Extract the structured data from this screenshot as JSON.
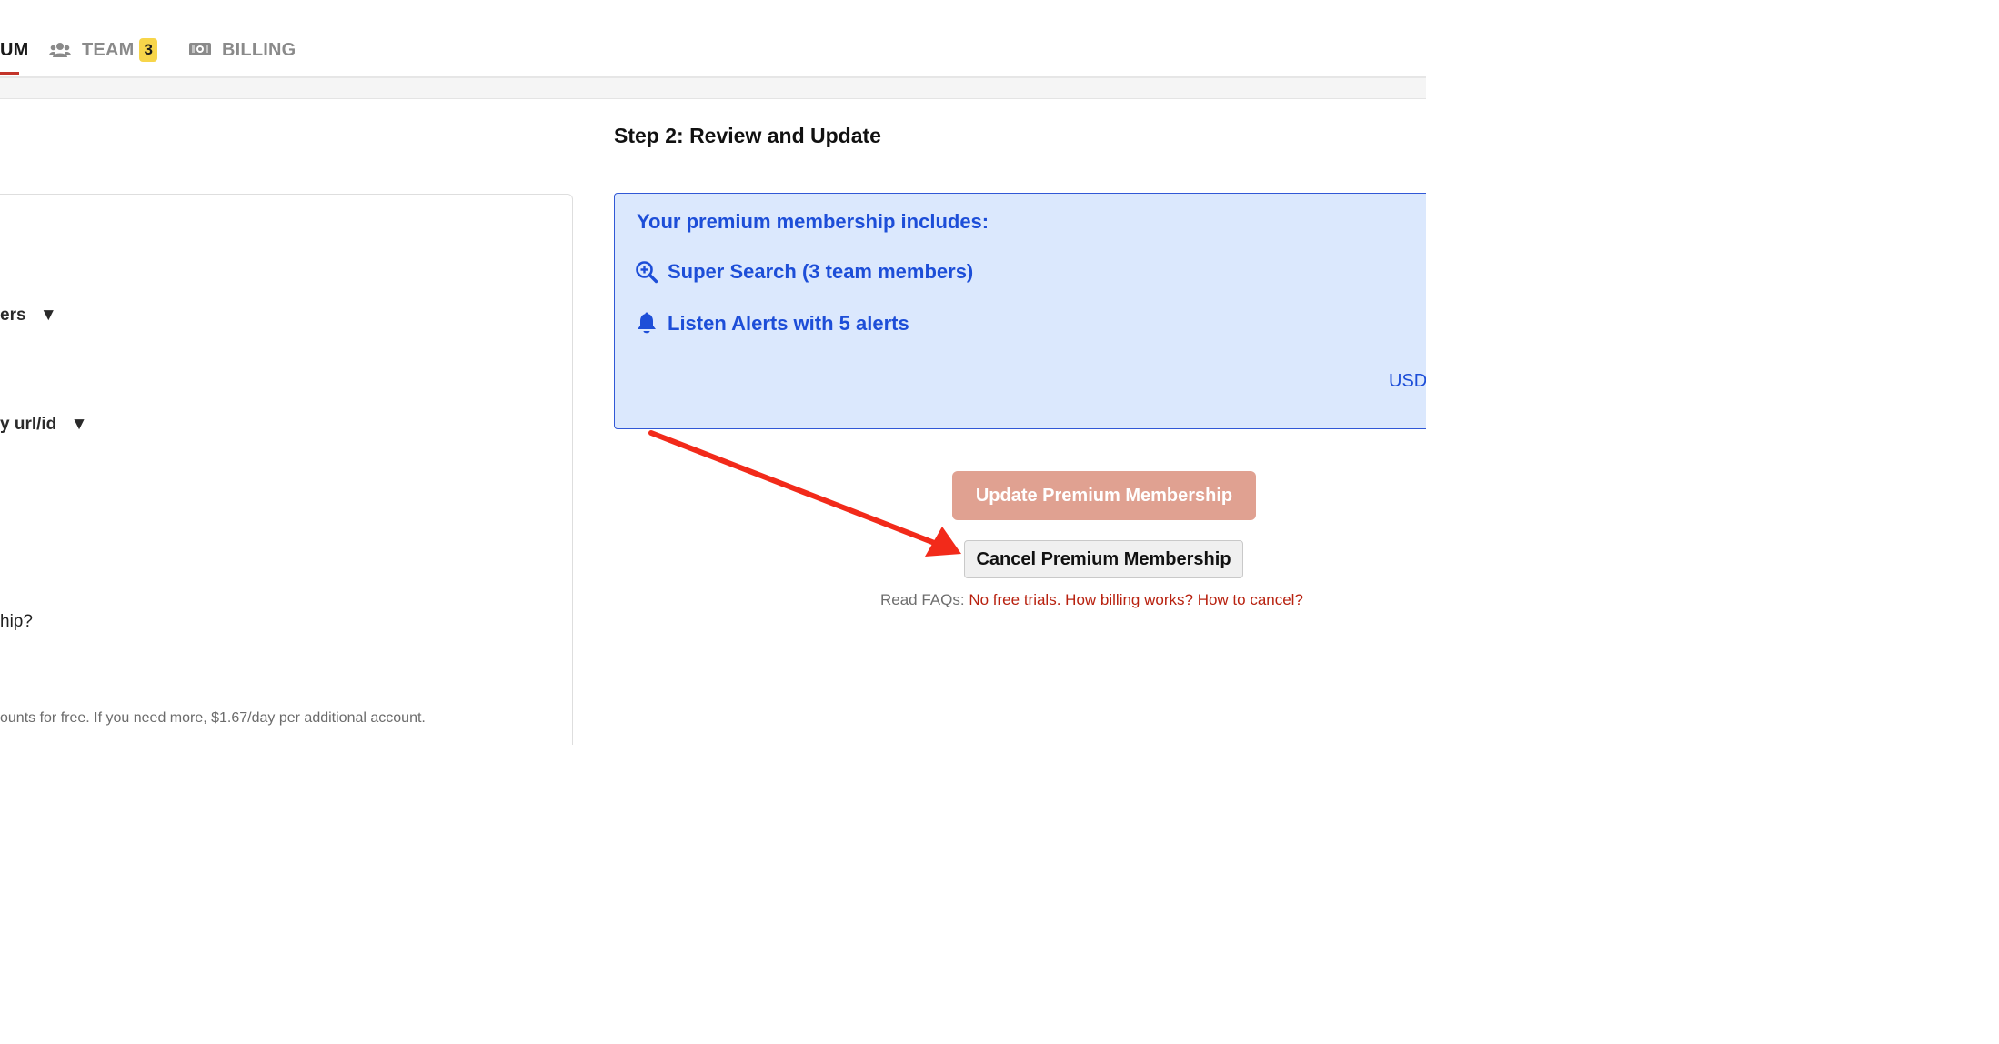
{
  "tabs": {
    "premium_partial": "UM",
    "team": "TEAM",
    "team_count": "3",
    "billing": "BILLING"
  },
  "left": {
    "item1_partial": "ers",
    "item1_caret": "▼",
    "item2_partial": "y url/id",
    "item2_caret": "▼",
    "question_partial": "hip?",
    "note_partial": "ounts for free. If you need more, $1.67/day per additional account."
  },
  "step2": {
    "title": "Step 2: Review and Update",
    "box_title": "Your premium membership includes:",
    "features": [
      {
        "label": "Super Search (3 team members)",
        "icon": "zoom-in-icon"
      },
      {
        "label": "Listen Alerts with 5 alerts",
        "icon": "bell-icon"
      }
    ],
    "currency_partial": "USD",
    "update_button": "Update Premium Membership",
    "cancel_button": "Cancel Premium Membership",
    "faq_prefix": "Read FAQs:",
    "faq_links": [
      "No free trials.",
      "How billing works?",
      "How to cancel?"
    ]
  },
  "colors": {
    "accent_red": "#c3342a",
    "blue": "#1d4ed8",
    "blue_bg": "#dbe8fd",
    "update_btn": "#e0a191",
    "arrow": "#f22a1a"
  }
}
